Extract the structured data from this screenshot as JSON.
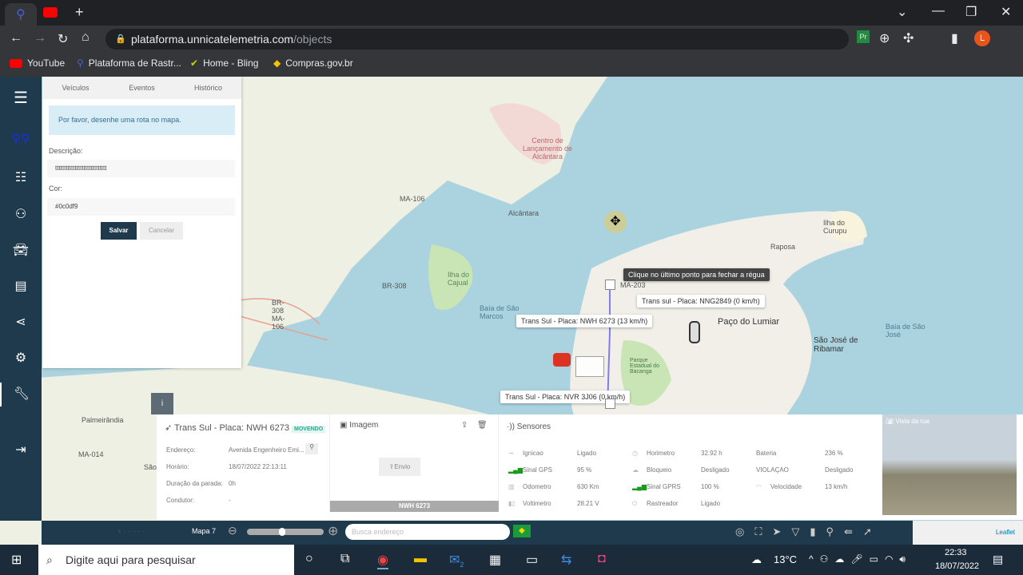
{
  "browser": {
    "url_host": "plataforma.unnicatelemetria.com",
    "url_path": "/objects",
    "bookmarks": [
      {
        "label": "YouTube"
      },
      {
        "label": "Plataforma de Rastr..."
      },
      {
        "label": "Home - Bling"
      },
      {
        "label": "Compras.gov.br"
      }
    ],
    "profile_initial": "L"
  },
  "panel": {
    "tabs": [
      "Veículos",
      "Eventos",
      "Histórico"
    ],
    "alert": "Por favor, desenhe uma rota no mapa.",
    "description_label": "Descrição:",
    "description_value": "ttttttttttttttttttttttttttttt",
    "color_label": "Cor:",
    "color_value": "#0c0df9",
    "save": "Salvar",
    "cancel": "Cancelar"
  },
  "map": {
    "labels": [
      "Centro de Lançamento de Alcântara",
      "Alcântara",
      "MA-106",
      "BR-308",
      "Ilha do Cajual",
      "Baía de São Marcos",
      "Raposa",
      "Ilha do Curupu",
      "Paço do Lumiar",
      "São José de Ribamar",
      "Baía de São José",
      "Palmeirândia",
      "MA-014",
      "São",
      "MA-203",
      "BR-308 MA-106",
      "Parque Estadual do Bacanga"
    ],
    "tooltips": {
      "ruler": "Clique no último ponto para fechar a régua",
      "v1": "Trans sul - Placa: NNG2849 (0 km/h)",
      "v2": "Trans Sul - Placa: NWH 6273 (13 km/h)",
      "v3": "Trans Sul - Placa: NVR 3J06 (0 km/h)"
    },
    "route_color": "#0c0df9"
  },
  "vehicle": {
    "title": "Trans Sul - Placa: NWH 6273",
    "status": "MOVENDO",
    "fields": [
      {
        "label": "Endereço:",
        "value": "Avenida Engenheiro Emi..."
      },
      {
        "label": "Horário:",
        "value": "18/07/2022 22:13:11"
      },
      {
        "label": "Duração da parada:",
        "value": "0h"
      },
      {
        "label": "Condutor:",
        "value": "-"
      }
    ]
  },
  "image": {
    "title": "Imagem",
    "upload": "Envio",
    "plate": "NWH 6273"
  },
  "sensors": {
    "title": "Sensores",
    "items": [
      {
        "label": "Ignicao",
        "value": "Ligado"
      },
      {
        "label": "Sinal GPS",
        "value": "95 %"
      },
      {
        "label": "Odometro",
        "value": "630 Km"
      },
      {
        "label": "Voltimetro",
        "value": "28.21 V"
      },
      {
        "label": "Horimetro",
        "value": "32.92 h"
      },
      {
        "label": "Bloqueio",
        "value": "Desligado"
      },
      {
        "label": "Sinal GPRS",
        "value": "100 %"
      },
      {
        "label": "Rastreador",
        "value": "Ligado"
      },
      {
        "label": "Bateria",
        "value": "236 %"
      },
      {
        "label": "VIOLAÇAO",
        "value": "Desligado"
      },
      {
        "label": "Velocidade",
        "value": "13 km/h"
      }
    ]
  },
  "streetview": {
    "title": "Vista da rua"
  },
  "bottombar": {
    "map_label": "Mapa 7",
    "search_placeholder": "Busca endereço",
    "attribution": "Leaflet"
  },
  "taskbar": {
    "search": "Digite aqui para pesquisar",
    "temp": "13°C",
    "time": "22:33",
    "date": "18/07/2022",
    "mail_badge": "2"
  }
}
